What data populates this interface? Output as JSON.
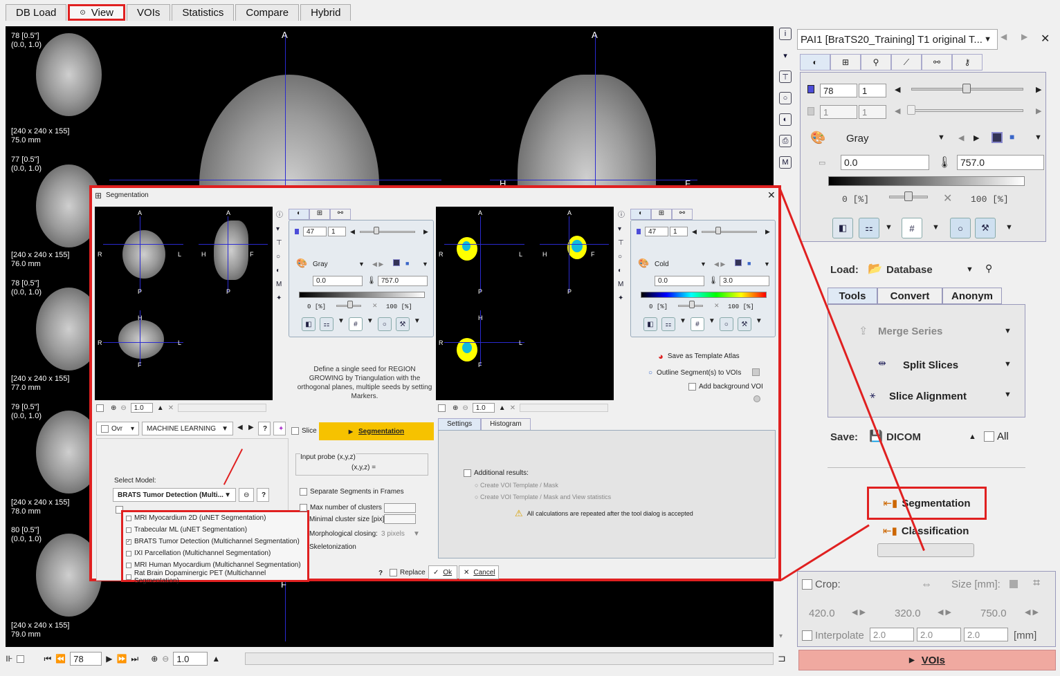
{
  "tabs": [
    "DB Load",
    "View",
    "VOIs",
    "Statistics",
    "Compare",
    "Hybrid"
  ],
  "thumbs": [
    {
      "line1": "78 [0.5\"]",
      "line2": "(0.0, 1.0)",
      "dims": "[240 x 240 x 155]",
      "mm": "75.0 mm"
    },
    {
      "line1": "77 [0.5\"]",
      "line2": "(0.0, 1.0)",
      "dims": "[240 x 240 x 155]",
      "mm": "76.0 mm"
    },
    {
      "line1": "78 [0.5\"]",
      "line2": "(0.0, 1.0)",
      "dims": "[240 x 240 x 155]",
      "mm": "77.0 mm"
    },
    {
      "line1": "79 [0.5\"]",
      "line2": "(0.0, 1.0)",
      "dims": "[240 x 240 x 155]",
      "mm": "78.0 mm"
    },
    {
      "line1": "80 [0.5\"]",
      "line2": "(0.0, 1.0)",
      "dims": "[240 x 240 x 155]",
      "mm": "79.0 mm"
    }
  ],
  "orient": {
    "a": "A",
    "h": "H",
    "f": "F"
  },
  "bottom": {
    "slice": "78",
    "zoom": "1.0"
  },
  "right": {
    "series": "PAI1 [BraTS20_Training] T1 original T...",
    "slice": "78",
    "frame": "1",
    "frame_dis1": "1",
    "frame_dis2": "1",
    "lut": "Gray",
    "min": "0.0",
    "max": "757.0",
    "pct_lo": "0",
    "pct_hi": "100",
    "pct_unit": "[%]",
    "load_label": "Load:",
    "load_src": "Database",
    "tool_tabs": [
      "Tools",
      "Convert",
      "Anonym"
    ],
    "tools": [
      "Merge Series",
      "Split Slices",
      "Slice Alignment"
    ],
    "save_label": "Save:",
    "save_fmt": "DICOM",
    "save_all": "All",
    "segmentation": "Segmentation",
    "classification": "Classification",
    "crop": "Crop:",
    "size_mm": "Size [mm]:",
    "crop_vals": [
      "420.0",
      "320.0",
      "750.0"
    ],
    "interpolate": "Interpolate",
    "interp_vals": [
      "2.0",
      "2.0",
      "2.0"
    ],
    "interp_unit": "[mm]",
    "vois_btn": "VOIs"
  },
  "dialog": {
    "title": "Segmentation",
    "left": {
      "slice": "47",
      "frame": "1",
      "lut": "Gray",
      "min": "0.0",
      "max": "757.0",
      "pct_lo": "0",
      "pct_hi": "100",
      "pct_unit": "[%]",
      "zoom": "1.0"
    },
    "right": {
      "slice": "47",
      "frame": "1",
      "lut": "Cold",
      "min": "0.0",
      "max": "3.0",
      "pct_lo": "0",
      "pct_hi": "100",
      "pct_unit": "[%]",
      "zoom": "1.0"
    },
    "labels": {
      "a": "A",
      "p": "P",
      "r": "R",
      "l": "L",
      "h": "H",
      "f": "F"
    },
    "ovr": "Ovr",
    "ml": "MACHINE LEARNING",
    "slice_cb": "Slice",
    "seg_btn": "Segmentation",
    "info": "Define a single seed for REGION GROWING by Triangulation with the orthogonal planes, multiple seeds by setting Markers.",
    "input_probe": "Input probe (x,y,z)",
    "xyz": "(x,y,z) =",
    "select_model": "Select Model:",
    "model": "BRATS Tumor Detection (Multi...",
    "models": [
      "MRI Myocardium 2D (uNET Segmentation)",
      "Trabecular ML (uNET Segmentation)",
      "BRATS Tumor Detection (Multichannel Segmentation)",
      "IXI Parcellation (Multichannel Segmentation)",
      "MRI Human Myocardium (Multichannel Segmentation)",
      "Rat Brain Dopaminergic PET (Multichannel Segmentation)"
    ],
    "sep_segments": "Separate Segments in Frames",
    "max_clusters": "Max number of clusters",
    "min_cluster": "Minimal cluster size [pix]",
    "morph": "Morphological closing:",
    "morph_val": "3 pixels",
    "skel": "Skeletonization",
    "save_atlas": "Save as Template Atlas",
    "outline": "Outline Segment(s) to VOIs",
    "add_bg": "Add background VOI",
    "settings_tab": "Settings",
    "histogram_tab": "Histogram",
    "additional": "Additional results:",
    "create1": "Create VOI Template / Mask",
    "create2": "Create VOI Template / Mask and View statistics",
    "warning": "All calculations are repeated after the tool dialog is accepted",
    "help": "?",
    "replace": "Replace",
    "ok": "Ok",
    "cancel": "Cancel"
  }
}
